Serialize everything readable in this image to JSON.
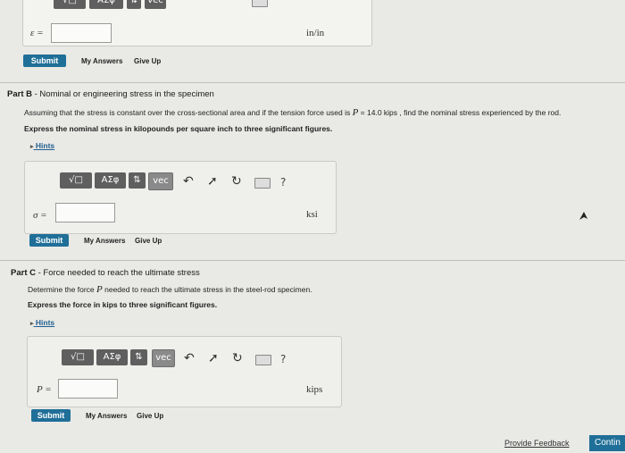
{
  "toolbar": {
    "templates_label": "√□",
    "greek_label": "AΣφ",
    "sort_label": "⇅",
    "vec_label": "vec",
    "undo_icon": "undo-icon",
    "redo_icon": "redo-icon",
    "reset_icon": "reset-icon",
    "keyboard_icon": "keyboard-icon",
    "help_label": "?"
  },
  "part_a": {
    "answer_label": "ε =",
    "unit": "in/in",
    "submit": "Submit",
    "my_answers": "My Answers",
    "give_up": "Give Up"
  },
  "part_b": {
    "part_prefix": "Part B",
    "title": " - Nominal or engineering stress in the specimen",
    "description_pre": "Assuming that the stress is constant over the cross-sectional area and if the tension force used is ",
    "description_var": "P",
    "description_post": " = 14.0 kips , find the nominal stress experienced by the rod.",
    "instruction": "Express the nominal stress in kilopounds per square inch to three significant figures.",
    "hints": "Hints",
    "answer_label": "σ =",
    "unit": "ksi",
    "submit": "Submit",
    "my_answers": "My Answers",
    "give_up": "Give Up"
  },
  "part_c": {
    "part_prefix": "Part C",
    "title": " - Force needed to reach the ultimate stress",
    "description_pre": "Determine the force ",
    "description_var": "P",
    "description_post": " needed to reach the ultimate stress in the steel-rod specimen.",
    "instruction": "Express the force in kips to three significant figures.",
    "hints": "Hints",
    "answer_label": "P =",
    "unit": "kips",
    "submit": "Submit",
    "my_answers": "My Answers",
    "give_up": "Give Up"
  },
  "footer": {
    "provide_feedback": "Provide Feedback",
    "continue": "Contin"
  }
}
